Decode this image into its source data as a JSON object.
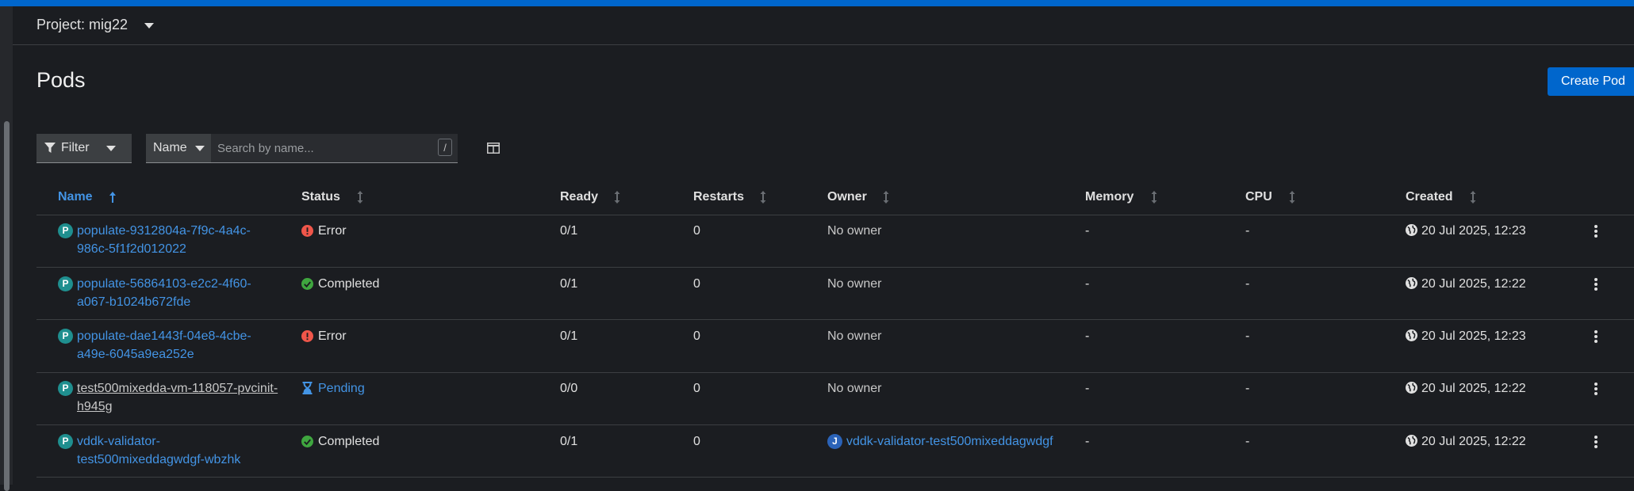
{
  "project": {
    "label": "Project: mig22"
  },
  "page": {
    "title": "Pods",
    "create_label": "Create Pod"
  },
  "toolbar": {
    "filter_label": "Filter",
    "name_select": "Name",
    "search_placeholder": "Search by name...",
    "search_shortcut": "/"
  },
  "columns": [
    "Name",
    "Status",
    "Ready",
    "Restarts",
    "Owner",
    "Memory",
    "CPU",
    "Created"
  ],
  "rows": [
    {
      "badge": "P",
      "name_line1": "populate-9312804a-7f9c-4a4c-",
      "name_line2": "986c-5f1f2d012022",
      "status": "Error",
      "ready": "0/1",
      "restarts": "0",
      "owner_badge": "",
      "owner": "No owner",
      "memory": "-",
      "cpu": "-",
      "created": "20 Jul 2025, 12:23"
    },
    {
      "badge": "P",
      "name_line1": "populate-56864103-e2c2-4f60-",
      "name_line2": "a067-b1024b672fde",
      "status": "Completed",
      "ready": "0/1",
      "restarts": "0",
      "owner_badge": "",
      "owner": "No owner",
      "memory": "-",
      "cpu": "-",
      "created": "20 Jul 2025, 12:22"
    },
    {
      "badge": "P",
      "name_line1": "populate-dae1443f-04e8-4cbe-",
      "name_line2": "a49e-6045a9ea252e",
      "status": "Error",
      "ready": "0/1",
      "restarts": "0",
      "owner_badge": "",
      "owner": "No owner",
      "memory": "-",
      "cpu": "-",
      "created": "20 Jul 2025, 12:23"
    },
    {
      "badge": "P",
      "name_line1": "test500mixedda-vm-118057-pvcinit-",
      "name_line2": "h945g",
      "status": "Pending",
      "ready": "0/0",
      "restarts": "0",
      "owner_badge": "",
      "owner": "No owner",
      "memory": "-",
      "cpu": "-",
      "created": "20 Jul 2025, 12:22"
    },
    {
      "badge": "P",
      "name_line1": "vddk-validator-",
      "name_line2": "test500mixeddagwdgf-wbzhk",
      "status": "Completed",
      "ready": "0/1",
      "restarts": "0",
      "owner_badge": "J",
      "owner": "vddk-validator-test500mixeddagwdgf",
      "memory": "-",
      "cpu": "-",
      "created": "20 Jul 2025, 12:22"
    }
  ],
  "colors": {
    "accent": "#0066cc",
    "link": "#4394e5",
    "error": "#f0564a",
    "success": "#3fa63f",
    "pending": "#4394e5",
    "pod_badge": "#1f8f8f",
    "job_badge": "#2b63b8"
  },
  "icons": {
    "project_dropdown": "caret-down-icon",
    "filter": "filter-icon",
    "column_management": "columns-icon",
    "sort_active": "arrow-up-icon",
    "sort_inactive": "sort-icon",
    "error": "exclamation-circle-icon",
    "completed": "check-circle-icon",
    "pending": "hourglass-icon",
    "created": "globe-icon",
    "row_actions": "kebab-icon"
  }
}
